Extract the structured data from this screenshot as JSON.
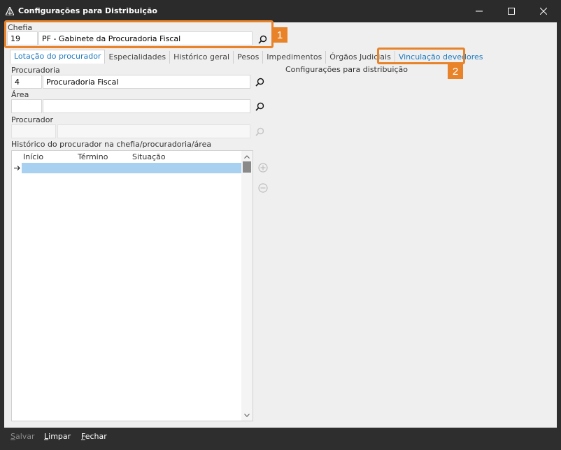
{
  "window": {
    "title": "Configurações para Distribuição"
  },
  "chefia": {
    "label": "Chefia",
    "code": "19",
    "name": "PF - Gabinete da Procuradoria Fiscal",
    "badge": "1"
  },
  "tabs": [
    {
      "label": "Lotação do procurador",
      "active": true
    },
    {
      "label": "Especialidades",
      "active": false
    },
    {
      "label": "Histórico geral",
      "active": false
    },
    {
      "label": "Pesos",
      "active": false
    },
    {
      "label": "Impedimentos",
      "active": false
    },
    {
      "label": "Órgãos Judiciais",
      "active": false
    },
    {
      "label": "Vinculação devedores",
      "active": false,
      "highlighted": true
    }
  ],
  "tab_badge": "2",
  "lotacao": {
    "procuradoria_label": "Procuradoria",
    "procuradoria_code": "4",
    "procuradoria_name": "Procuradoria Fiscal",
    "area_label": "Área",
    "area_code": "",
    "area_name": "",
    "procurador_label": "Procurador",
    "procurador_code": "",
    "procurador_name": "",
    "historico_label": "Histórico do procurador na chefia/procuradoria/área",
    "grid_columns": [
      "Início",
      "Término",
      "Situação"
    ],
    "config_label": "Configurações para distribuição"
  },
  "footer": {
    "salvar": {
      "first": "S",
      "rest": "alvar"
    },
    "limpar": {
      "first": "L",
      "rest": "impar"
    },
    "fechar": {
      "first": "F",
      "rest": "echar"
    }
  },
  "colors": {
    "highlight": "#e8832a",
    "accent": "#1f7bbf",
    "selected_row": "#a8d0f0"
  }
}
